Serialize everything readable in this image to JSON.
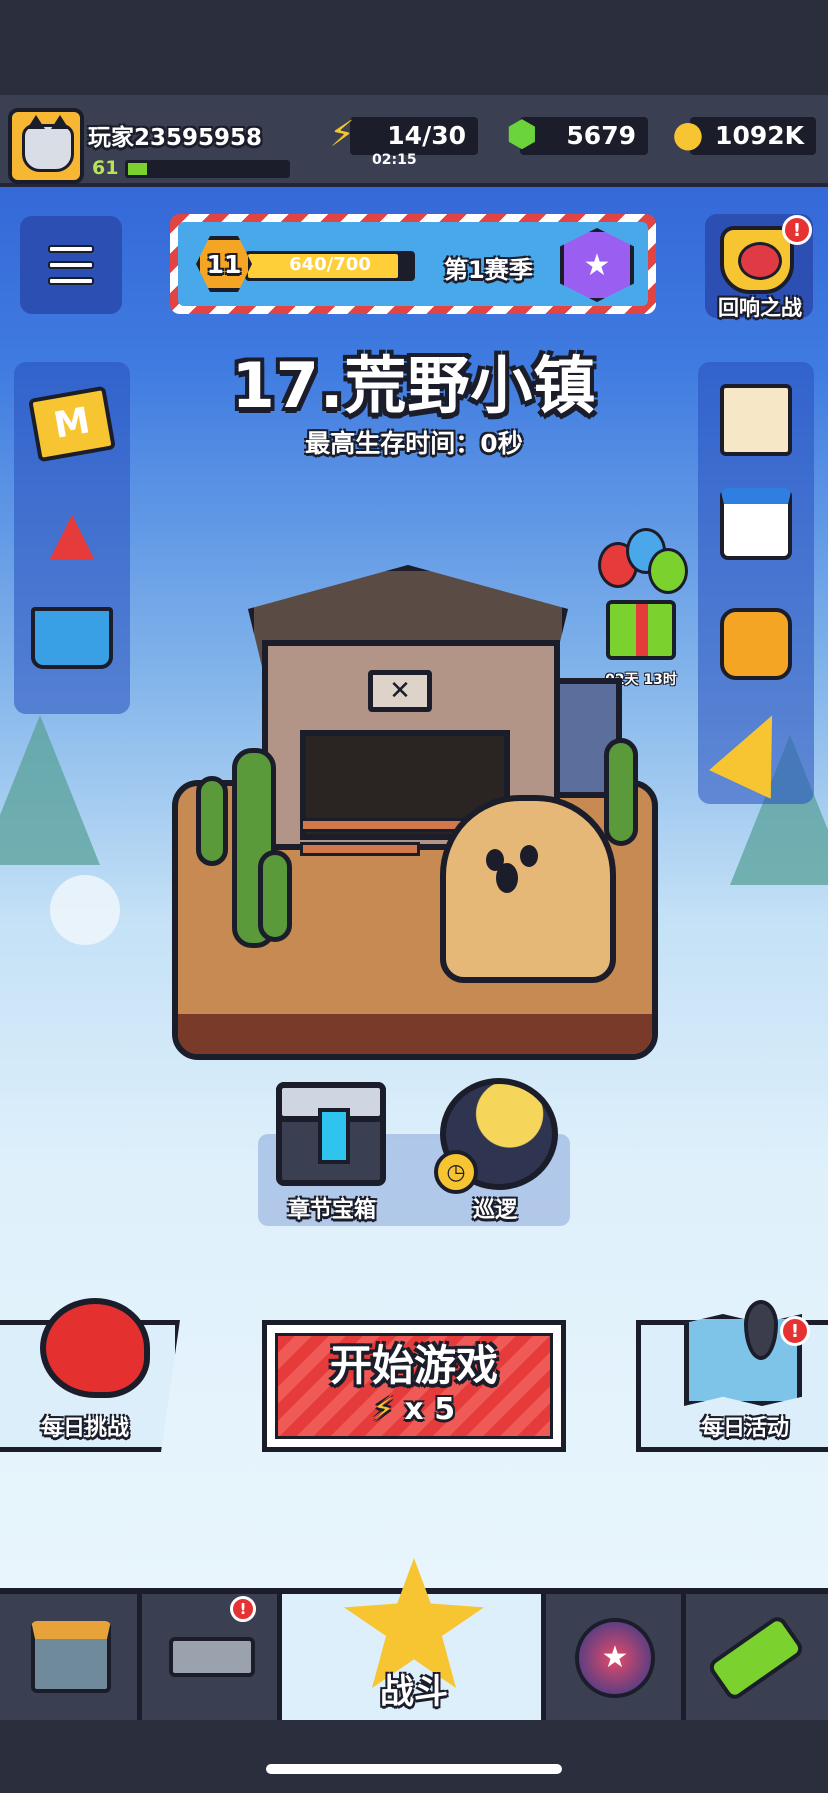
{
  "player": {
    "name": "玩家23595958",
    "level": "61",
    "xp_fraction": 0.12
  },
  "resources": {
    "energy": "14/30",
    "energy_timer": "02:15",
    "gems": "5679",
    "coins": "1092K"
  },
  "season": {
    "level": "11",
    "progress": "640/700",
    "progress_fraction": 0.914,
    "name": "第1赛季"
  },
  "echo_battle": {
    "label": "回响之战",
    "alert": "!"
  },
  "level": {
    "title": "17.荒野小镇",
    "best_survival": "最高生存时间：0秒"
  },
  "gift": {
    "timer": "02天 13时"
  },
  "chest": {
    "label": "章节宝箱"
  },
  "patrol": {
    "label": "巡逻"
  },
  "actions": {
    "daily_challenge": "每日挑战",
    "start_game": "开始游戏",
    "start_cost": "x 5",
    "daily_event": "每日活动",
    "daily_event_alert": "!"
  },
  "nav": {
    "battle_label": "战斗",
    "weapon_alert": "!"
  },
  "colors": {
    "accent_red": "#e53b3b",
    "gold": "#f7c531",
    "energy_green": "#7bd12e",
    "sky_blue": "#3f7be0"
  },
  "icons": {
    "menu": "menu-icon",
    "energy": "lightning-icon",
    "gem": "gem-icon",
    "coin": "coin-icon",
    "shop": "shop-icon",
    "weapon": "revolver-icon",
    "battle": "star-swords-icon",
    "talent": "star-orb-icon",
    "gene": "dna-capsule-icon"
  }
}
